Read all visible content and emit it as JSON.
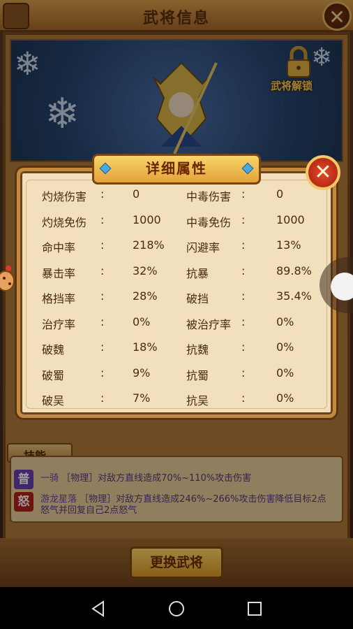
{
  "header": {
    "title": "武将信息"
  },
  "hero_panel": {
    "unlock_label": "武将解锁"
  },
  "dialog": {
    "title": "详细属性",
    "separator": ":",
    "rows": [
      {
        "l_label": "灼烧伤害",
        "l_value": "0",
        "r_label": "中毒伤害",
        "r_value": "0"
      },
      {
        "l_label": "灼烧免伤",
        "l_value": "1000",
        "r_label": "中毒免伤",
        "r_value": "1000"
      },
      {
        "l_label": "命中率",
        "l_value": "218%",
        "r_label": "闪避率",
        "r_value": "13%"
      },
      {
        "l_label": "暴击率",
        "l_value": "32%",
        "r_label": "抗暴",
        "r_value": "89.8%"
      },
      {
        "l_label": "格挡率",
        "l_value": "28%",
        "r_label": "破挡",
        "r_value": "35.4%"
      },
      {
        "l_label": "治疗率",
        "l_value": "0%",
        "r_label": "被治疗率",
        "r_value": "0%"
      },
      {
        "l_label": "破魏",
        "l_value": "18%",
        "r_label": "抗魏",
        "r_value": "0%"
      },
      {
        "l_label": "破蜀",
        "l_value": "9%",
        "r_label": "抗蜀",
        "r_value": "0%"
      },
      {
        "l_label": "破吴",
        "l_value": "7%",
        "r_label": "抗吴",
        "r_value": "0%"
      }
    ]
  },
  "skills": {
    "tab_label": "技能",
    "items": [
      {
        "icon_char": "普",
        "icon_color": "#6a3cb0",
        "name": "一骑",
        "desc": "［物理］对敌方直线造成70%~110%攻击伤害"
      },
      {
        "icon_char": "怒",
        "icon_color": "#b0201a",
        "name": "游龙星落",
        "desc": "［物理］对敌方直线造成246%~266%攻击伤害降低目标2点怒气并回复自己2点怒气"
      }
    ]
  },
  "footer": {
    "change_button": "更换武将"
  },
  "icons": {
    "close": "close-icon",
    "lock": "lock-icon",
    "nav_back": "back-triangle-icon",
    "nav_home": "home-circle-icon",
    "nav_recent": "recent-square-icon"
  },
  "colors": {
    "accent_gold": "#e5a23a",
    "dialog_bg": "#f1e0bb",
    "close_red": "#c8321c"
  }
}
